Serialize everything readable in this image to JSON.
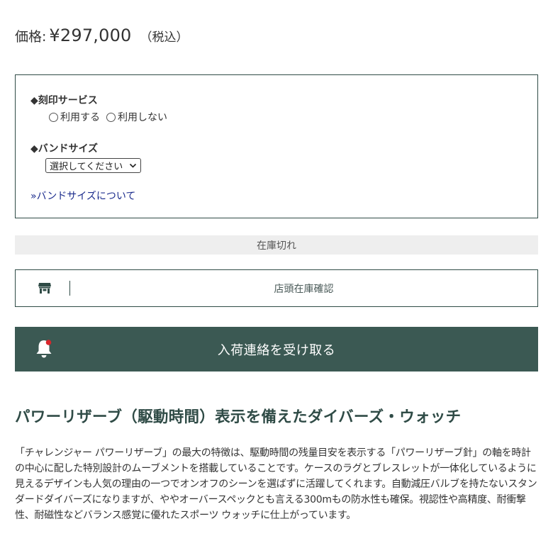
{
  "price": {
    "label": "価格:",
    "value": "¥297,000",
    "tax": "（税込）"
  },
  "options": {
    "engraving": {
      "heading": "◆刻印サービス",
      "choices": [
        "利用する",
        "利用しない"
      ],
      "selected": null
    },
    "band": {
      "heading": "◆バンドサイズ",
      "select_value": "選択してください",
      "link_label": "»バンドサイズについて"
    }
  },
  "stock_status": "在庫切れ",
  "store_check": {
    "label": "店頭在庫確認",
    "icon": "store-icon"
  },
  "notify": {
    "label": "入荷連絡を受け取る",
    "icon": "bell-icon"
  },
  "description": {
    "title": "パワーリザーブ（駆動時間）表示を備えたダイバーズ・ウォッチ",
    "body": "「チャレンジャー パワーリザーブ」の最大の特徴は、駆動時間の残量目安を表示する「パワーリザーブ針」の軸を時計の中心に配した特別設計のムーブメントを搭載していることです。ケースのラグとブレスレットが一体化しているように見えるデザインも人気の理由の一つでオンオフのシーンを選ばずに活躍してくれます。自動減圧バルブを持たないスタンダードダイバーズになりますが、ややオーバースペックとも言える300mもの防水性も確保。視認性や高精度、耐衝撃性、耐磁性などバランス感覚に優れたスポーツ ウォッチに仕上がっています。"
  },
  "colors": {
    "accent": "#3b5953",
    "border": "#2f4b46",
    "link": "#1a2b8c",
    "bell_dot": "#d9262b",
    "stock_bg": "#eeeeee"
  }
}
